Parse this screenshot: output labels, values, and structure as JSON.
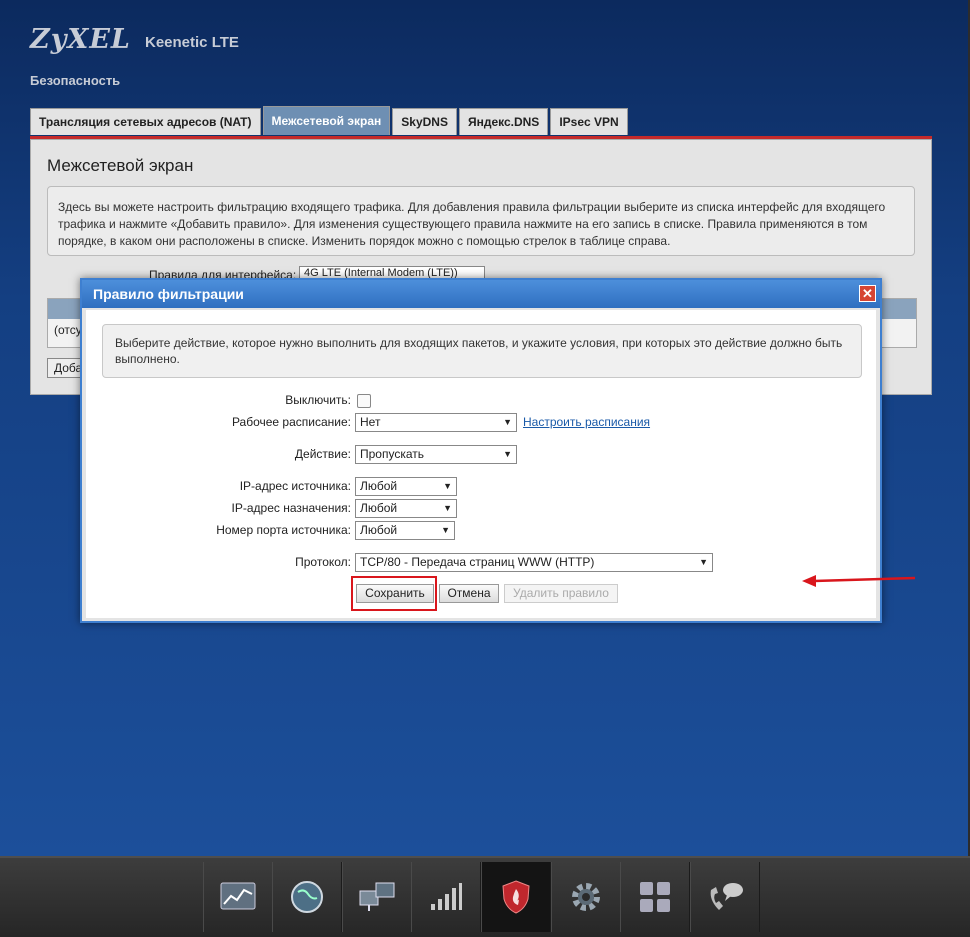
{
  "header": {
    "brand": "ZyXEL",
    "product": "Keenetic LTE",
    "section": "Безопасность"
  },
  "tabs": [
    {
      "label": "Трансляция сетевых адресов (NAT)",
      "active": false
    },
    {
      "label": "Межсетевой экран",
      "active": true
    },
    {
      "label": "SkyDNS",
      "active": false
    },
    {
      "label": "Яндекс.DNS",
      "active": false
    },
    {
      "label": "IPsec VPN",
      "active": false
    }
  ],
  "panel": {
    "title": "Межсетевой экран",
    "description": "Здесь вы можете настроить фильтрацию входящего трафика. Для добавления правила фильтрации выберите из списка интерфейс для входящего трафика и нажмите «Добавить правило». Для изменения существующего правила нажмите на его запись в списке. Правила применяются в том порядке, в каком они расположены в списке. Изменить порядок можно с помощью стрелок в таблице справа.",
    "interface_label": "Правила для интерфейса:",
    "interface_value": "4G LTE (Internal Modem (LTE))",
    "table_row_text": "(отсу",
    "add_button": "Доба"
  },
  "dialog": {
    "title": "Правило фильтрации",
    "close": "✕",
    "description": "Выберите действие, которое нужно выполнить для входящих пакетов, и укажите условия, при которых это действие должно быть выполнено.",
    "fields": {
      "disable_label": "Выключить:",
      "schedule_label": "Рабочее расписание:",
      "schedule_value": "Нет",
      "schedule_link": "Настроить расписания",
      "action_label": "Действие:",
      "action_value": "Пропускать",
      "src_ip_label": "IP-адрес источника:",
      "src_ip_value": "Любой",
      "dst_ip_label": "IP-адрес назначения:",
      "dst_ip_value": "Любой",
      "src_port_label": "Номер порта источника:",
      "src_port_value": "Любой",
      "protocol_label": "Протокол:",
      "protocol_value": "TCP/80 - Передача страниц WWW (HTTP)"
    },
    "buttons": {
      "save": "Сохранить",
      "cancel": "Отмена",
      "delete": "Удалить правило"
    }
  },
  "colors": {
    "highlight": "#d9161c",
    "active_tab": "#6e8fb3",
    "tab_line": "#c52a2a",
    "dialog_title": "#2f6fc0"
  },
  "dock": [
    "chart-icon",
    "globe-icon",
    "network-icon",
    "signal-bars-icon",
    "shield-icon",
    "gear-icon",
    "apps-grid-icon",
    "phone-chat-icon"
  ],
  "dock_active": "shield-icon"
}
